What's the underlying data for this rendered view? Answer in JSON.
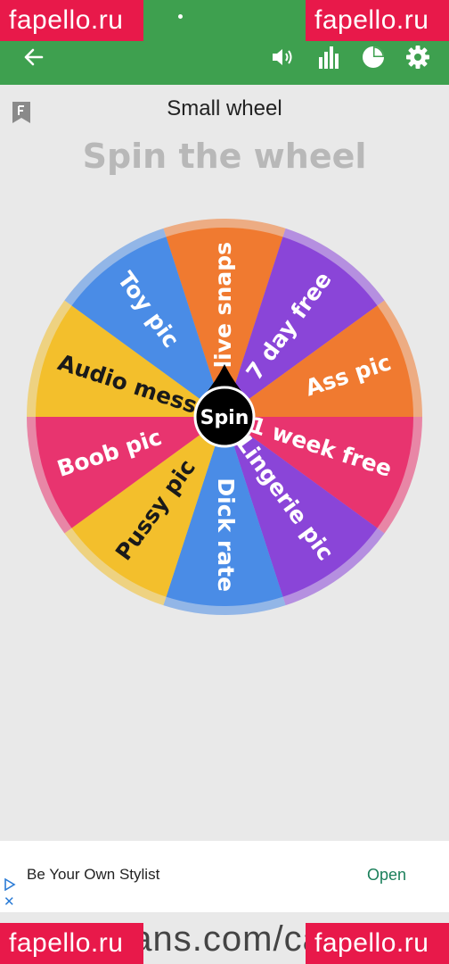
{
  "watermark": {
    "text": "fapello.ru"
  },
  "toolbar": {
    "back_icon": "arrow-left-icon",
    "volume_icon": "volume-icon",
    "stats_icon": "bar-chart-icon",
    "pie_icon": "pie-chart-icon",
    "settings_icon": "gear-icon"
  },
  "header": {
    "wheel_name": "Small wheel",
    "title": "Spin the wheel"
  },
  "wheel": {
    "center_label": "Spin",
    "segments": [
      {
        "label": "2 live snaps",
        "color": "#f07a30"
      },
      {
        "label": "7 day free",
        "color": "#8a45d8"
      },
      {
        "label": "Ass pic",
        "color": "#f07a30"
      },
      {
        "label": "1 week free",
        "color": "#e8346f"
      },
      {
        "label": "Lingerie pic",
        "color": "#8a45d8"
      },
      {
        "label": "Dick rate",
        "color": "#4a8ce6"
      },
      {
        "label": "Pussy pic",
        "color": "#f3bf2c"
      },
      {
        "label": "Boob pic",
        "color": "#e8346f"
      },
      {
        "label": "Audio message",
        "color": "#f3bf2c"
      },
      {
        "label": "Toy pic",
        "color": "#4a8ce6"
      }
    ]
  },
  "ad": {
    "text": "Be Your Own Stylist",
    "open_label": "Open"
  },
  "bottom": {
    "text": "fans.com/cas"
  }
}
